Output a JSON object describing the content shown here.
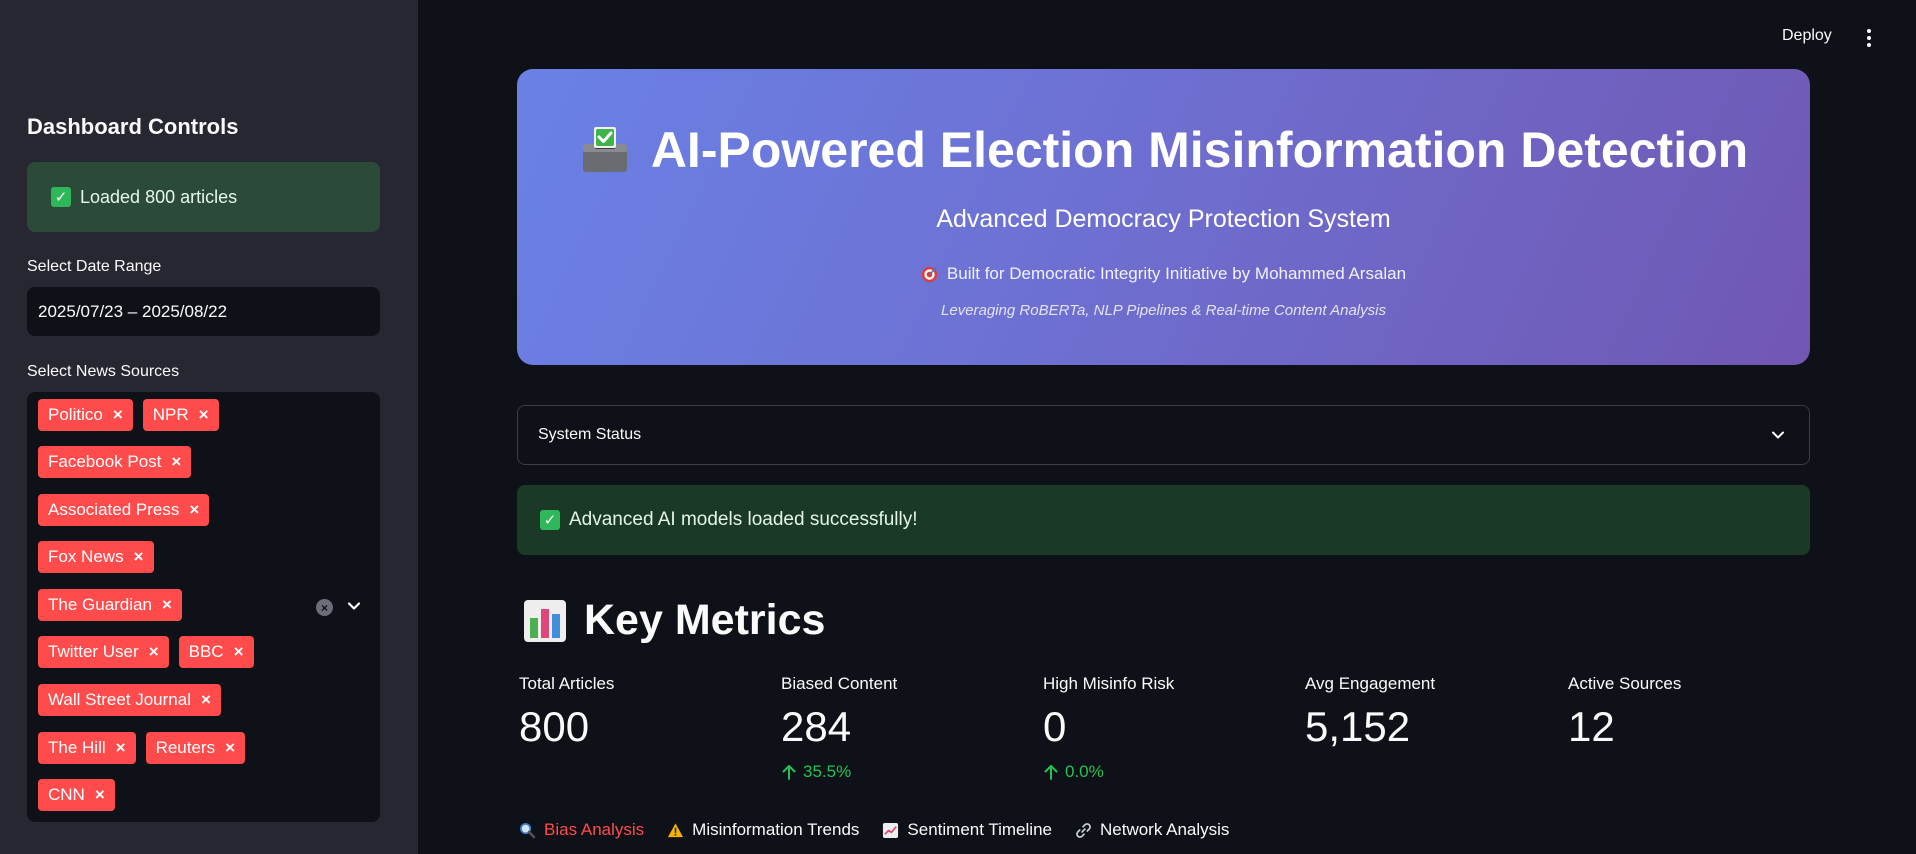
{
  "sidebar": {
    "title": "Dashboard Controls",
    "load_message": "Loaded 800 articles",
    "date_label": "Select Date Range",
    "date_value": "2025/07/23 – 2025/08/22",
    "sources_label": "Select News Sources",
    "selected_sources": [
      "Politico",
      "NPR",
      "Facebook Post",
      "Associated Press",
      "Fox News",
      "The Guardian",
      "Twitter User",
      "BBC",
      "Wall Street Journal",
      "The Hill",
      "Reuters",
      "CNN"
    ]
  },
  "header": {
    "deploy_label": "Deploy",
    "menu_icon": "kebab-menu-icon"
  },
  "hero": {
    "icon": "ballot-box-icon",
    "title": "AI-Powered Election Misinformation Detection",
    "subtitle": "Advanced Democracy Protection System",
    "built_icon": "target-icon",
    "built_by": "Built for Democratic Integrity Initiative by Mohammed Arsalan",
    "tagline": "Leveraging RoBERTa, NLP Pipelines & Real-time Content Analysis"
  },
  "system_status": {
    "label": "System Status"
  },
  "models_message": "Advanced AI models loaded successfully!",
  "key_metrics": {
    "icon": "bar-chart-icon",
    "title": "Key Metrics",
    "metrics": [
      {
        "label": "Total Articles",
        "value": "800",
        "delta": ""
      },
      {
        "label": "Biased Content",
        "value": "284",
        "delta": "35.5%"
      },
      {
        "label": "High Misinfo Risk",
        "value": "0",
        "delta": "0.0%"
      },
      {
        "label": "Avg Engagement",
        "value": "5,152",
        "delta": ""
      },
      {
        "label": "Active Sources",
        "value": "12",
        "delta": ""
      }
    ]
  },
  "tabs": [
    {
      "icon": "magnifier-icon",
      "label": "Bias Analysis",
      "active": true
    },
    {
      "icon": "warning-icon",
      "label": "Misinformation Trends",
      "active": false
    },
    {
      "icon": "trend-chart-icon",
      "label": "Sentiment Timeline",
      "active": false
    },
    {
      "icon": "link-icon",
      "label": "Network Analysis",
      "active": false
    }
  ],
  "colors": {
    "background": "#0e1117",
    "sidebar": "#262730",
    "accent": "#ff4b4b",
    "success_bg": "#1b3927",
    "delta_positive": "#21c354",
    "hero_start": "#6a81e6",
    "hero_end": "#7157b3"
  }
}
